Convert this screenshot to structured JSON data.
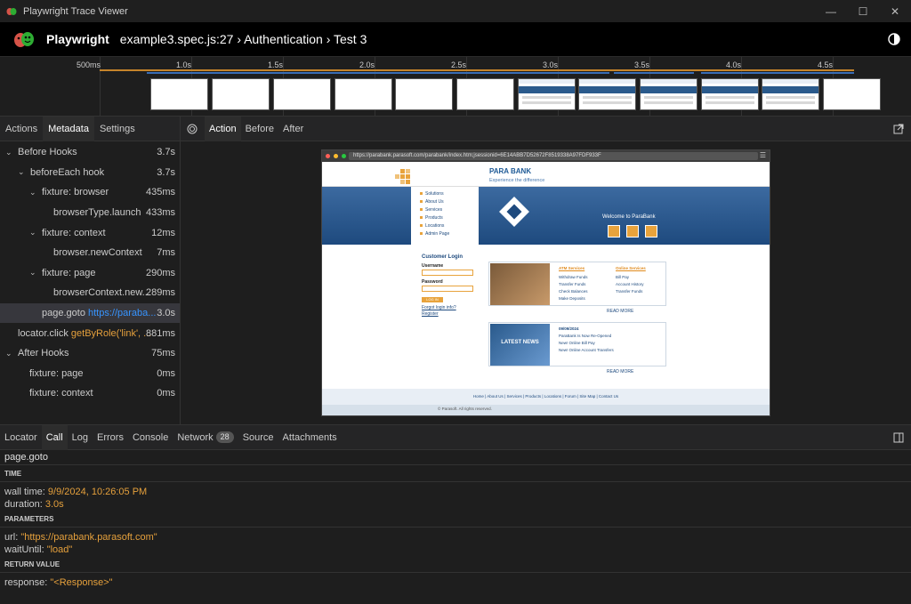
{
  "window": {
    "title": "Playwright Trace Viewer"
  },
  "header": {
    "brand": "Playwright",
    "breadcrumb": "example3.spec.js:27 › Authentication › Test 3"
  },
  "timeline": {
    "ticks": [
      "500ms",
      "1.0s",
      "1.5s",
      "2.0s",
      "2.5s",
      "3.0s",
      "3.5s",
      "4.0s",
      "4.5s"
    ]
  },
  "left_panel": {
    "tabs": [
      "Actions",
      "Metadata",
      "Settings"
    ],
    "tree": [
      {
        "label": "Before Hooks",
        "duration": "3.7s"
      },
      {
        "label": "beforeEach hook",
        "duration": "3.7s"
      },
      {
        "label": "fixture: browser",
        "duration": "435ms"
      },
      {
        "label": "browserType.launch",
        "duration": "433ms"
      },
      {
        "label": "fixture: context",
        "duration": "12ms"
      },
      {
        "label": "browser.newContext",
        "duration": "7ms"
      },
      {
        "label": "fixture: page",
        "duration": "290ms"
      },
      {
        "label": "browserContext.new...",
        "duration": "289ms"
      },
      {
        "label": "page.goto",
        "arg": "https://paraba...",
        "duration": "3.0s"
      },
      {
        "label": "locator.click",
        "arg": "getByRole('link', ...",
        "duration": "881ms"
      },
      {
        "label": "After Hooks",
        "duration": "75ms"
      },
      {
        "label": "fixture: page",
        "duration": "0ms"
      },
      {
        "label": "fixture: context",
        "duration": "0ms"
      }
    ]
  },
  "center_panel": {
    "tabs": [
      "Action",
      "Before",
      "After"
    ],
    "browser": {
      "url": "https://parabank.parasoft.com/parabank/index.htm;jsessionid=6E14ABB7D52672F8519338A97FDF933F",
      "logo": "PARA BANK",
      "tagline": "Experience the difference",
      "menu": [
        "Solutions",
        "About Us",
        "Services",
        "Products",
        "Locations",
        "Admin Page"
      ],
      "welcome": "Welcome to ParaBank",
      "login": {
        "title": "Customer Login",
        "username_label": "Username",
        "password_label": "Password",
        "button": "LOG IN",
        "forgot": "Forgot login info?",
        "register": "Register"
      },
      "atm": {
        "title": "ATM Services",
        "items": [
          "Withdraw Funds",
          "Transfer Funds",
          "Check Balances",
          "Make Deposits"
        ]
      },
      "online": {
        "title": "Online Services",
        "items": [
          "Bill Pay",
          "Account History",
          "Transfer Funds"
        ]
      },
      "news": {
        "badge": "LATEST NEWS",
        "date": "09/09/2024",
        "items": [
          "ParaBank Is Now Re-Opened",
          "New! Online Bill Pay",
          "New! Online Account Transfers"
        ]
      },
      "read_more": "READ MORE",
      "footer": "Home  |  About Us  |  Services  |  Products  |  Locations  |  Forum  |  Site Map  |  Contact Us",
      "copyright": "© Parasoft. All rights reserved."
    }
  },
  "bottom_panel": {
    "tabs": [
      "Locator",
      "Call",
      "Log",
      "Errors",
      "Console",
      "Network",
      "Source",
      "Attachments"
    ],
    "network_count": "28",
    "call_title": "page.goto",
    "time_header": "TIME",
    "wall_time_label": "wall time:",
    "wall_time": "9/9/2024, 10:26:05 PM",
    "duration_label": "duration:",
    "duration": "3.0s",
    "params_header": "PARAMETERS",
    "url_label": "url:",
    "url": "\"https://parabank.parasoft.com\"",
    "wait_label": "waitUntil:",
    "wait": "\"load\"",
    "return_header": "RETURN VALUE",
    "response_label": "response:",
    "response": "\"<Response>\""
  }
}
